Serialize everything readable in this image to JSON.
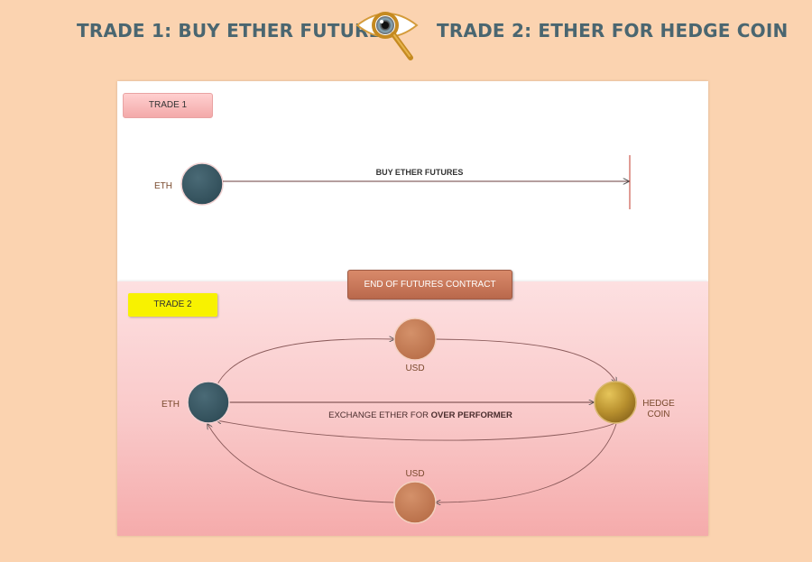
{
  "header": {
    "left_title": "TRADE 1: BUY ETHER FUTURES",
    "right_title": "TRADE 2: ETHER FOR HEDGE COIN"
  },
  "trade1": {
    "tag": "TRADE 1",
    "eth_label": "ETH",
    "arrow_label": "BUY ETHER FUTURES"
  },
  "end_contract": {
    "label": "END OF FUTURES CONTRACT"
  },
  "trade2": {
    "tag": "TRADE 2",
    "eth_label": "ETH",
    "usd_top_label": "USD",
    "usd_bottom_label": "USD",
    "hedge_label_line1": "HEDGE",
    "hedge_label_line2": "COIN",
    "exchange_label_prefix": "EXCHANGE ETHER FOR ",
    "exchange_label_bold": "OVER PERFORMER"
  },
  "colors": {
    "background": "#fbd3b0",
    "title_text": "#4a6670",
    "eth_node": "#3d5a66",
    "usd_node": "#c9815a",
    "hedge_node": "#c9a23a",
    "trade2_tag": "#f8f200",
    "end_tag": "#c47658"
  },
  "icons": {
    "header_center": "eye-magnifier-icon"
  }
}
